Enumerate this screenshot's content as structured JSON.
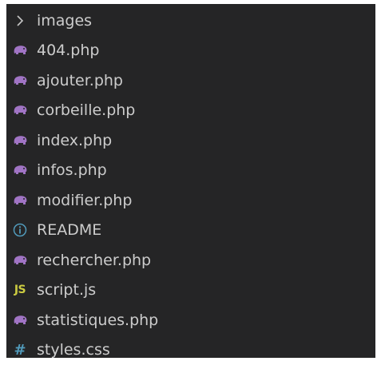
{
  "explorer": {
    "items": [
      {
        "kind": "folder",
        "label": "images",
        "icon": "chevron-right-icon"
      },
      {
        "kind": "php",
        "label": "404.php",
        "icon": "php-elephant-icon"
      },
      {
        "kind": "php",
        "label": "ajouter.php",
        "icon": "php-elephant-icon"
      },
      {
        "kind": "php",
        "label": "corbeille.php",
        "icon": "php-elephant-icon"
      },
      {
        "kind": "php",
        "label": "index.php",
        "icon": "php-elephant-icon"
      },
      {
        "kind": "php",
        "label": "infos.php",
        "icon": "php-elephant-icon"
      },
      {
        "kind": "php",
        "label": "modifier.php",
        "icon": "php-elephant-icon"
      },
      {
        "kind": "info",
        "label": "README",
        "icon": "info-icon"
      },
      {
        "kind": "php",
        "label": "rechercher.php",
        "icon": "php-elephant-icon"
      },
      {
        "kind": "js",
        "label": "script.js",
        "icon": "js-icon",
        "icon_text": "JS"
      },
      {
        "kind": "php",
        "label": "statistiques.php",
        "icon": "php-elephant-icon"
      },
      {
        "kind": "css",
        "label": "styles.css",
        "icon": "hash-icon",
        "icon_text": "#"
      }
    ]
  },
  "colors": {
    "panel_background": "#252526",
    "text": "#cccccc",
    "php_icon": "#a074c4",
    "info_icon": "#519aba",
    "js_icon": "#cbcb41",
    "css_icon": "#519aba"
  }
}
